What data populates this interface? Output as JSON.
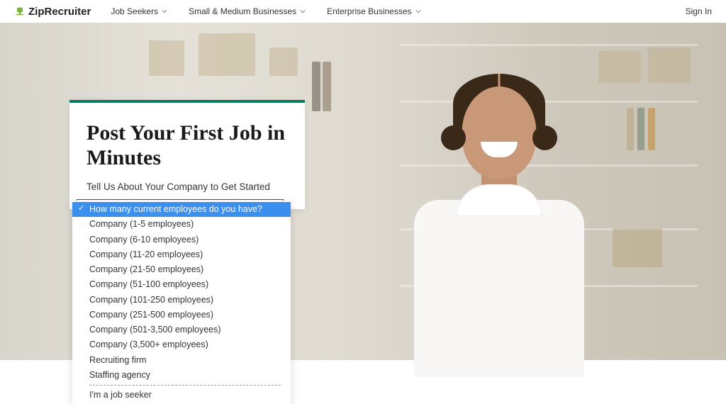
{
  "header": {
    "logo_text": "ZipRecruiter",
    "nav": [
      {
        "label": "Job Seekers"
      },
      {
        "label": "Small & Medium Businesses"
      },
      {
        "label": "Enterprise Businesses"
      }
    ],
    "signin": "Sign In"
  },
  "card": {
    "heading": "Post Your First Job in Minutes",
    "subheading": "Tell Us About Your Company to Get Started"
  },
  "dropdown": {
    "selected": "How many current employees do you have?",
    "options": [
      "Company (1-5 employees)",
      "Company (6-10 employees)",
      "Company (11-20 employees)",
      "Company (21-50 employees)",
      "Company (51-100 employees)",
      "Company (101-250 employees)",
      "Company (251-500 employees)",
      "Company (501-3,500 employees)",
      "Company (3,500+ employees)",
      "Recruiting firm",
      "Staffing agency"
    ],
    "after_divider": "I'm a job seeker"
  }
}
